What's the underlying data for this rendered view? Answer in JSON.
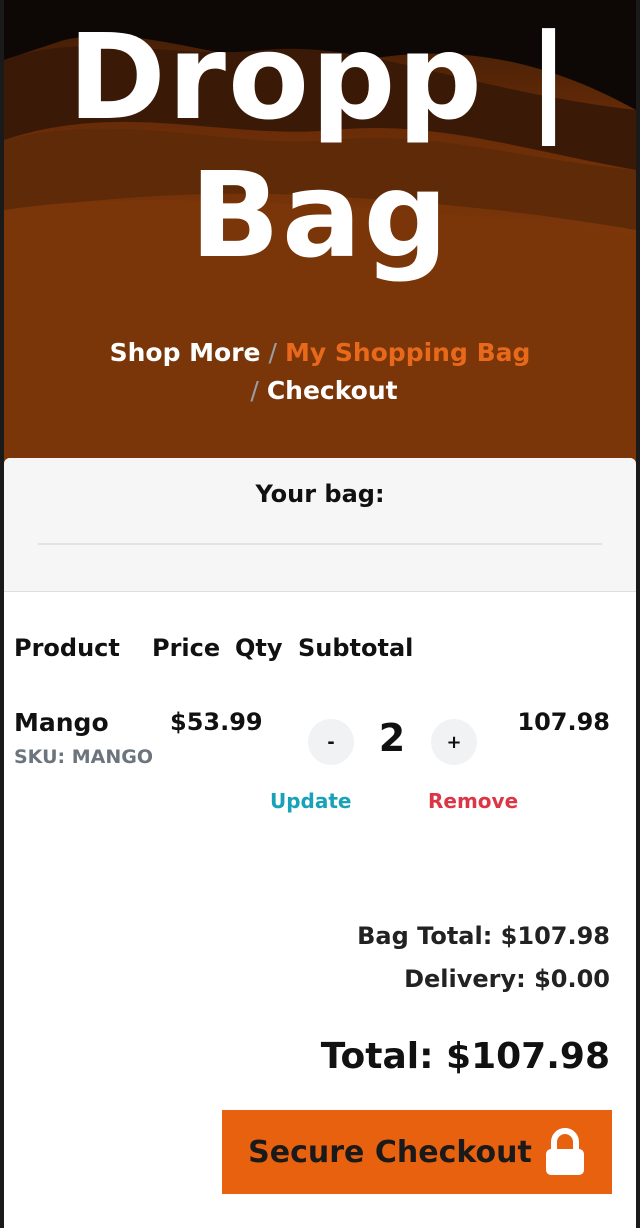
{
  "hero": {
    "title_line1": "Dropp |",
    "title_line2": "Bag"
  },
  "breadcrumb": {
    "home": "Shop More",
    "separator": "/",
    "active": "My Shopping Bag",
    "last": "Checkout"
  },
  "bag": {
    "title": "Your bag:",
    "columns": [
      "Product",
      "Price",
      "Qty",
      "Subtotal"
    ],
    "item": {
      "name": "Mango",
      "sku": "SKU: MANGO",
      "price": "$53.99",
      "qty": "2",
      "minus_label": "-",
      "plus_label": "+",
      "subtotal": "107.98",
      "update_label": "Update",
      "remove_label": "Remove"
    }
  },
  "totals": {
    "bag_total": "Bag Total: $107.98",
    "delivery": "Delivery: $0.00",
    "total": "Total: $107.98"
  },
  "checkout": {
    "label": "Secure Checkout",
    "icon": "lock-icon"
  },
  "colors": {
    "accent": "#e8610f",
    "breadcrumb_active": "#e8691a",
    "update": "#17a2b8",
    "remove": "#dc3545",
    "sku": "#6c757d"
  }
}
